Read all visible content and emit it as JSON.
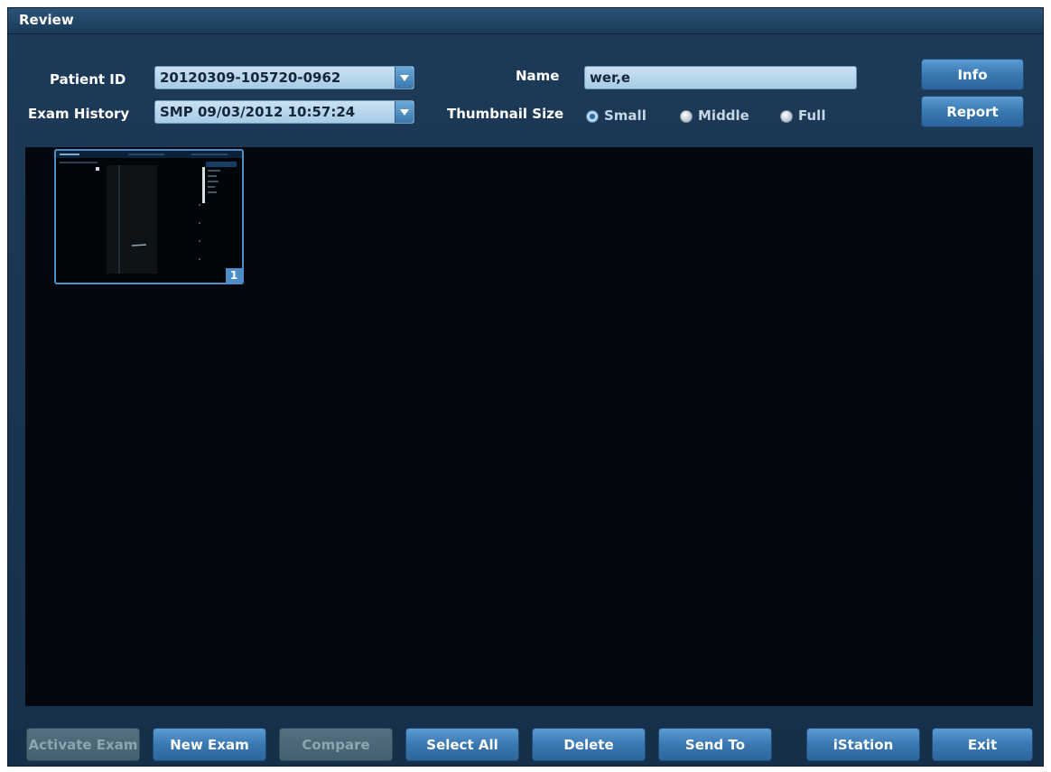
{
  "window": {
    "title": "Review"
  },
  "form": {
    "patient_id_label": "Patient ID",
    "patient_id_value": "20120309-105720-0962",
    "exam_history_label": "Exam History",
    "exam_history_value": "SMP 09/03/2012 10:57:24",
    "name_label": "Name",
    "name_value": "wer,e",
    "thumbnail_size_label": "Thumbnail Size",
    "thumbnail_options": [
      {
        "label": "Small",
        "selected": true
      },
      {
        "label": "Middle",
        "selected": false
      },
      {
        "label": "Full",
        "selected": false
      }
    ]
  },
  "side_buttons": {
    "info": "Info",
    "report": "Report"
  },
  "thumbnails": [
    {
      "index": "1"
    }
  ],
  "footer_buttons": {
    "activate_exam": "Activate Exam",
    "new_exam": "New Exam",
    "compare": "Compare",
    "select_all": "Select All",
    "delete": "Delete",
    "send_to": "Send To",
    "istation": "iStation",
    "exit": "Exit"
  },
  "colors": {
    "panel": "#16304a",
    "image_area": "#03080f",
    "button": "#3a78b2",
    "field": "#b6d4ea"
  }
}
